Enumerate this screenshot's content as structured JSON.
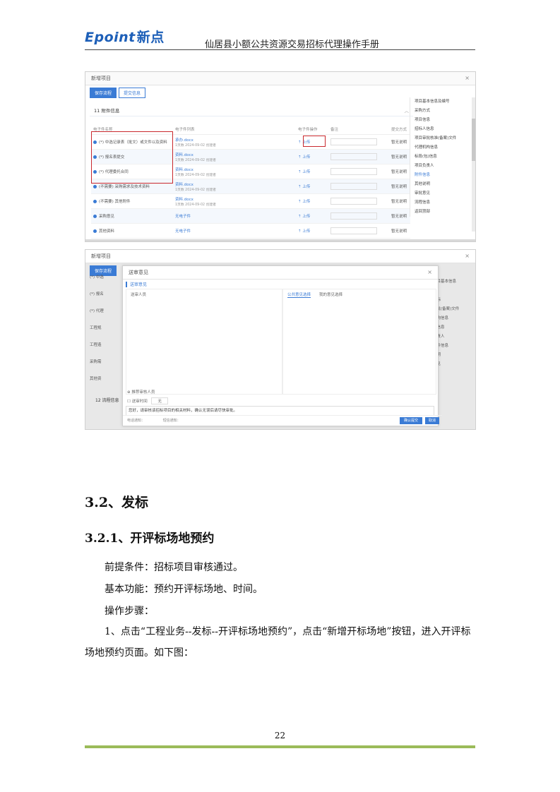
{
  "header": {
    "logo_text": "Epoint",
    "logo_cn": "新点",
    "title": "仙居县小额公共资源交易招标代理操作手册"
  },
  "screenshot1": {
    "dialog_title": "新增项目",
    "tabs": [
      "保存流程",
      "提交信息"
    ],
    "section": "11 附件信息",
    "columns": [
      "电子件名称",
      "电子件列表",
      "",
      "电子件操作",
      "备注",
      "提交方式"
    ],
    "rows": [
      {
        "name": "(*) 中选记录表（批文）或文件以及资料",
        "file": "承办.docx",
        "meta": "1页数 2024-09-02 创建者",
        "op": "上传",
        "remark": "",
        "mode": "暂无说明"
      },
      {
        "name": "(*) 报名表提交",
        "file": "资料.docx",
        "meta": "1页数 2024-09-02 创建者",
        "op": "上传",
        "remark": "",
        "mode": "暂无说明",
        "alt": true
      },
      {
        "name": "(*) 代理委托合同",
        "file": "资料.docx",
        "meta": "1页数 2024-09-02 创建者",
        "op": "上传",
        "remark": "",
        "mode": "暂无说明"
      },
      {
        "name": "(不需要) 采购需求及技术资料",
        "file": "资料.docx",
        "meta": "1页数 2024-09-02 创建者",
        "op": "上传",
        "remark": "",
        "mode": "暂无说明",
        "alt": true
      },
      {
        "name": "(不需要) 其他附件",
        "file": "资料.docx",
        "meta": "1页数 2024-09-02 创建者",
        "op": "上传",
        "remark": "",
        "mode": "暂无说明"
      },
      {
        "name": "采购意见",
        "file": "无电子件",
        "meta": "",
        "op": "上传",
        "remark": "",
        "mode": "暂无说明",
        "alt": true
      },
      {
        "name": "其他资料",
        "file": "无电子件",
        "meta": "",
        "op": "上传",
        "remark": "",
        "mode": "暂无说明"
      }
    ],
    "side_nav": [
      "项目基本信息及编号",
      "采购方式",
      "项目信息",
      "招标人信息",
      "项目审批核准(备案)文件",
      "代理机构信息",
      "标段(包)信息",
      "项目负责人",
      "附件信息",
      "其他说明",
      "审批意见",
      "流程信息",
      "返回顶部"
    ],
    "side_nav_current": 8
  },
  "screenshot2": {
    "dialog_title": "新增项目",
    "tab": "保存流程",
    "inner_title": "送审意见",
    "opinion_label": "送审意见",
    "left_pane_label": "送审人员",
    "right_tabs": [
      "公共意见选择",
      "我的意见选择"
    ],
    "checkbox_label": "推荐审核人员",
    "option_label": "送审时间",
    "option_value": "无",
    "opinion_text": "您好，请审核该招标项目的相关材料，确认无误后请尽快审批。",
    "footer_left": "电话通知：",
    "footer_mid": "短信通知：",
    "confirm_btn": "确认提交",
    "cancel_btn": "取消",
    "bg_left": [
      "(*) 中选",
      "(*) 报名",
      "(*) 代理",
      "工程规",
      "工程造",
      "采购需",
      "其他资"
    ],
    "bg_right": [
      "项目基本信息",
      "",
      "招标",
      "审批(备案)文件",
      "机构信息",
      "包信息",
      "负责人",
      "附件信息",
      "说明",
      "意见"
    ],
    "bg_section": "12 流程信息"
  },
  "content": {
    "h2": "3.2、发标",
    "h3": "3.2.1、开评标场地预约",
    "p1": "前提条件：招标项目审核通过。",
    "p2": "基本功能：预约开评标场地、时间。",
    "p3": "操作步骤：",
    "p4": "1、点击“工程业务--发标--开评标场地预约”，点击“新增开标场地”按钮，进入开评标场地预约页面。如下图："
  },
  "page_number": "22",
  "colors": {
    "accent": "#3a7bd5",
    "highlight": "#c9282d",
    "footer_bar": "#9bbb59",
    "logo": "#1d5fb8"
  }
}
